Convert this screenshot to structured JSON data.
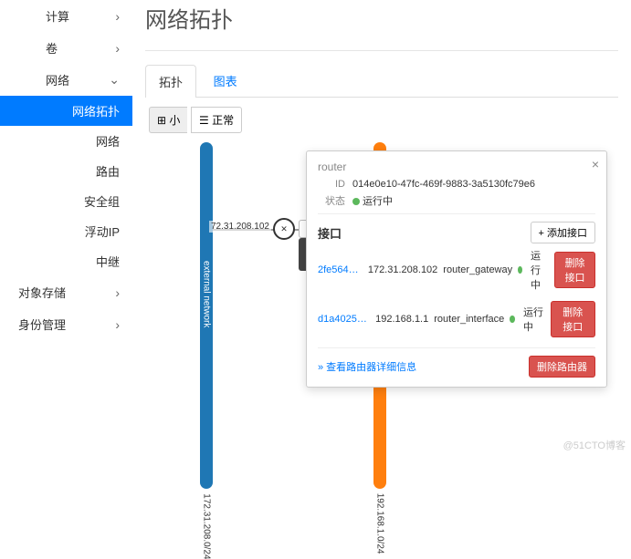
{
  "sidebar": {
    "compute": "计算",
    "volumes": "卷",
    "network": "网络",
    "network_items": [
      "网络拓扑",
      "网络",
      "路由",
      "安全组",
      "浮动IP",
      "中继"
    ],
    "object_storage": "对象存储",
    "identity": "身份管理"
  },
  "page_title": "网络拓扑",
  "tabs": {
    "topology": "拓扑",
    "graph": "图表"
  },
  "toolbar": {
    "small": "小",
    "normal": "正常",
    "grid_icon": "⊞",
    "list_icon": "☰"
  },
  "networks": {
    "external": {
      "label": "external network",
      "cidr": "172.31.208.0/24"
    },
    "internal": {
      "cidr": "192.168.1.0/24"
    }
  },
  "node": {
    "name": "router",
    "type": "路由",
    "ip_left": "72.31.208.102"
  },
  "popup": {
    "title": "router",
    "id_label": "ID",
    "id": "014e0e10-47fc-469f-9883-3a5130fc79e6",
    "status_label": "状态",
    "status": "运行中",
    "interfaces_title": "接口",
    "add_interface": "+ 添加接口",
    "interfaces": [
      {
        "id": "2fe564e2-cd...",
        "ip": "172.31.208.102",
        "type": "router_gateway",
        "status": "运行中",
        "delete": "删除接口"
      },
      {
        "id": "d1a40252-8b...",
        "ip": "192.168.1.1",
        "type": "router_interface",
        "status": "运行中",
        "delete": "删除接口"
      }
    ],
    "detail_link": "» 查看路由器详细信息",
    "delete_router": "删除路由器"
  },
  "watermark": "@51CTO博客"
}
